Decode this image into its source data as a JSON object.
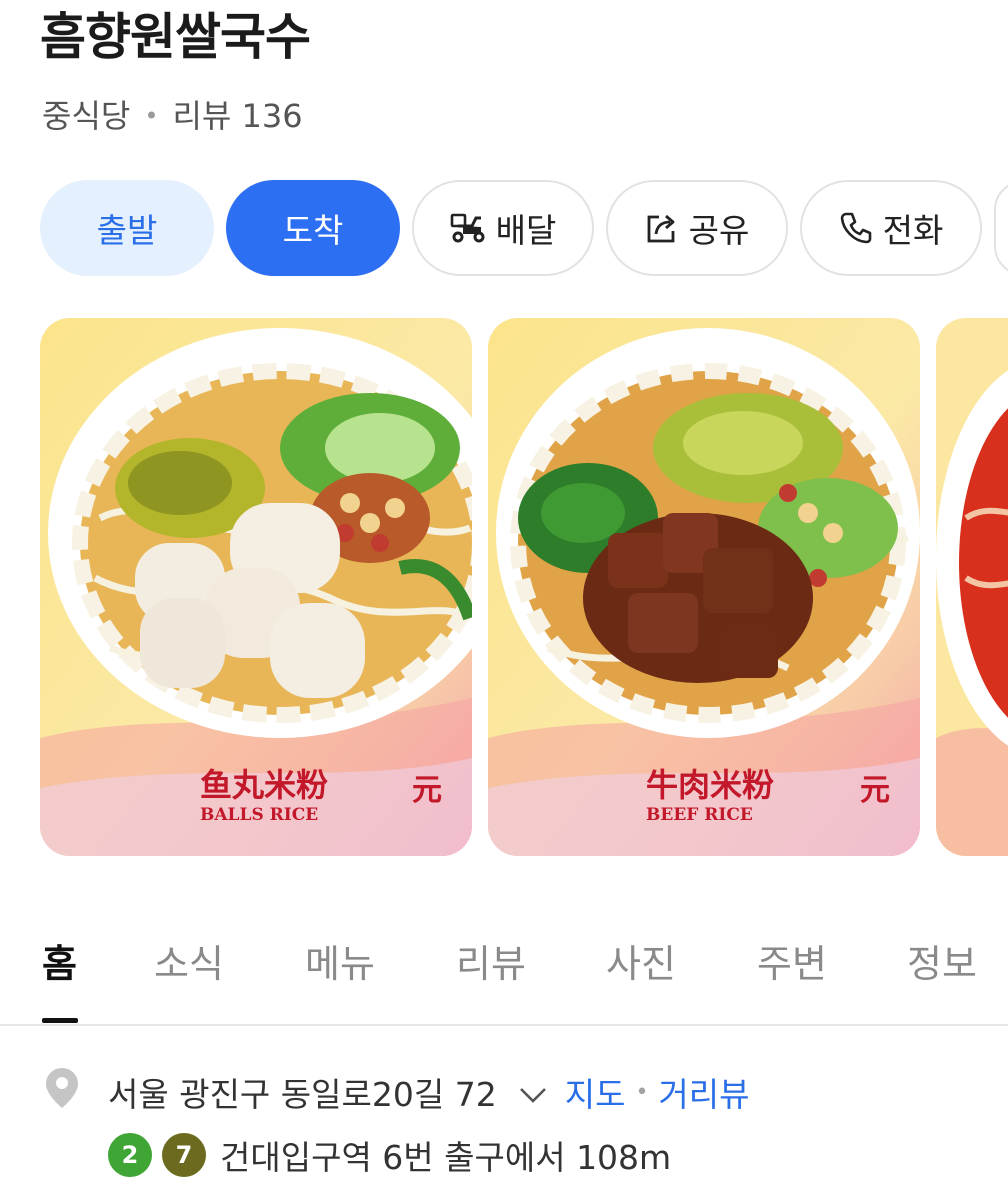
{
  "place": {
    "name": "흠향원쌀국수",
    "category": "중식당",
    "review_label": "리뷰 136"
  },
  "actions": {
    "depart": "출발",
    "arrive": "도착",
    "delivery": "배달",
    "share": "공유",
    "call": "전화"
  },
  "photos": [
    {
      "cn_text": "鱼丸米粉",
      "en_text": "BALLS RICE",
      "price_text": "元"
    },
    {
      "cn_text": "牛肉米粉",
      "en_text": "BEEF RICE",
      "price_text": "元"
    }
  ],
  "tabs": [
    "홈",
    "소식",
    "메뉴",
    "리뷰",
    "사진",
    "주변",
    "정보"
  ],
  "active_tab": "홈",
  "address": {
    "text": "서울 광진구 동일로20길 72",
    "map_link": "지도",
    "roadview_link": "거리뷰"
  },
  "station": {
    "lines": [
      {
        "number": "2",
        "color": "#3fa535"
      },
      {
        "number": "7",
        "color": "#6b6a1e"
      }
    ],
    "text": "건대입구역 6번 출구에서 108m"
  },
  "colors": {
    "accent": "#2d6ff2",
    "accent_light": "#e4f0fe",
    "link": "#2a6ee8"
  },
  "icons": {
    "delivery": "delivery-scooter-icon",
    "share": "share-icon",
    "call": "phone-icon",
    "location": "location-pin-icon",
    "dropdown": "chevron-down-icon"
  }
}
